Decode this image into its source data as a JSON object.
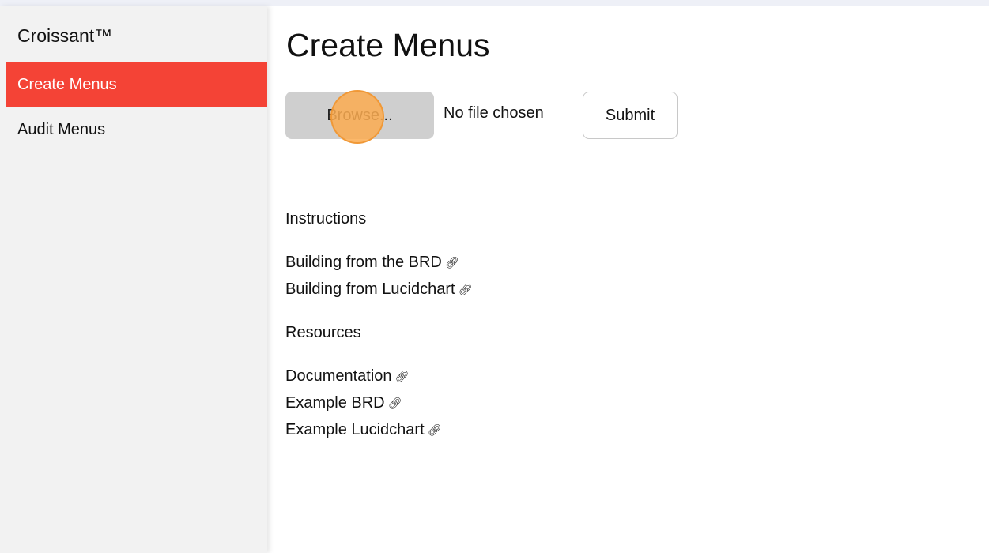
{
  "sidebar": {
    "brand": "Croissant™",
    "items": [
      {
        "label": "Create Menus",
        "active": true
      },
      {
        "label": "Audit Menus",
        "active": false
      }
    ]
  },
  "main": {
    "title": "Create Menus",
    "upload": {
      "browse_label": "Browse...",
      "file_status": "No file chosen",
      "submit_label": "Submit"
    },
    "instructions": {
      "heading": "Instructions",
      "links": [
        "Building from the BRD",
        "Building from Lucidchart"
      ]
    },
    "resources": {
      "heading": "Resources",
      "links": [
        "Documentation",
        "Example BRD",
        "Example Lucidchart"
      ]
    },
    "link_icon": "link-icon"
  },
  "colors": {
    "accent": "#f44336",
    "sidebar_bg": "#f2f2f2",
    "button_gray": "#cfcfcf",
    "click_indicator": "#fcab50"
  }
}
